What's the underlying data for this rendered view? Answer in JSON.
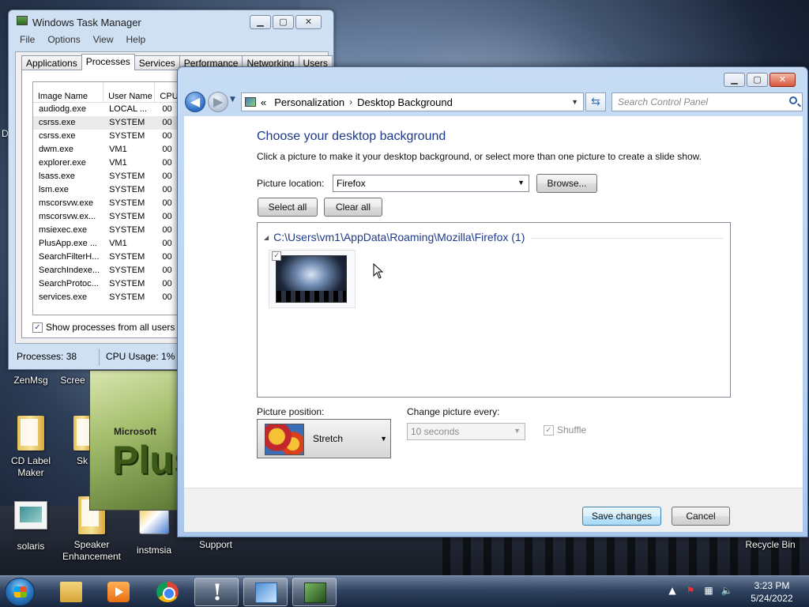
{
  "desktop": {
    "left_edge_letter": "D",
    "icons": [
      {
        "label": "ZenMsg"
      },
      {
        "label": "Scree"
      },
      {
        "label": "CD Label Maker"
      },
      {
        "label": "Sk"
      },
      {
        "label": "solaris"
      },
      {
        "label": "Speaker Enhancement"
      },
      {
        "label": "instmsia"
      },
      {
        "label": "Support"
      },
      {
        "label": "Recycle Bin"
      }
    ],
    "promo": {
      "brand": "Microsoft",
      "word": "Plus"
    }
  },
  "task_manager": {
    "title": "Windows Task Manager",
    "menu": [
      "File",
      "Options",
      "View",
      "Help"
    ],
    "tabs": [
      "Applications",
      "Processes",
      "Services",
      "Performance",
      "Networking",
      "Users"
    ],
    "active_tab": "Processes",
    "columns": {
      "name": "Image Name",
      "user": "User Name",
      "cpu": "CPU"
    },
    "rows": [
      {
        "name": "audiodg.exe",
        "user": "LOCAL ...",
        "cpu": "00"
      },
      {
        "name": "csrss.exe",
        "user": "SYSTEM",
        "cpu": "00"
      },
      {
        "name": "csrss.exe",
        "user": "SYSTEM",
        "cpu": "00"
      },
      {
        "name": "dwm.exe",
        "user": "VM1",
        "cpu": "00"
      },
      {
        "name": "explorer.exe",
        "user": "VM1",
        "cpu": "00"
      },
      {
        "name": "lsass.exe",
        "user": "SYSTEM",
        "cpu": "00"
      },
      {
        "name": "lsm.exe",
        "user": "SYSTEM",
        "cpu": "00"
      },
      {
        "name": "mscorsvw.exe",
        "user": "SYSTEM",
        "cpu": "00"
      },
      {
        "name": "mscorsvw.ex...",
        "user": "SYSTEM",
        "cpu": "00"
      },
      {
        "name": "msiexec.exe",
        "user": "SYSTEM",
        "cpu": "00"
      },
      {
        "name": "PlusApp.exe ...",
        "user": "VM1",
        "cpu": "00"
      },
      {
        "name": "SearchFilterH...",
        "user": "SYSTEM",
        "cpu": "00"
      },
      {
        "name": "SearchIndexe...",
        "user": "SYSTEM",
        "cpu": "00"
      },
      {
        "name": "SearchProtoc...",
        "user": "SYSTEM",
        "cpu": "00"
      },
      {
        "name": "services.exe",
        "user": "SYSTEM",
        "cpu": "00"
      }
    ],
    "show_all_label": "Show processes from all users",
    "show_all_checked": true,
    "status": {
      "processes": "Processes: 38",
      "cpu": "CPU Usage: 1%"
    }
  },
  "control_panel": {
    "breadcrumb": {
      "prefix": "«",
      "items": [
        "Personalization",
        "Desktop Background"
      ],
      "separator": "›"
    },
    "search_placeholder": "Search Control Panel",
    "heading": "Choose your desktop background",
    "subtitle": "Click a picture to make it your desktop background, or select more than one picture to create a slide show.",
    "picture_location_label": "Picture location:",
    "picture_location_value": "Firefox",
    "browse_label": "Browse...",
    "select_all_label": "Select all",
    "clear_all_label": "Clear all",
    "group_title": "C:\\Users\\vm1\\AppData\\Roaming\\Mozilla\\Firefox (1)",
    "thumbnail_checked": true,
    "picture_position_label": "Picture position:",
    "picture_position_value": "Stretch",
    "change_every_label": "Change picture every:",
    "change_every_value": "10 seconds",
    "shuffle_label": "Shuffle",
    "shuffle_checked": true,
    "save_label": "Save changes",
    "cancel_label": "Cancel"
  },
  "taskbar": {
    "clock_time": "3:23 PM",
    "clock_date": "5/24/2022"
  }
}
